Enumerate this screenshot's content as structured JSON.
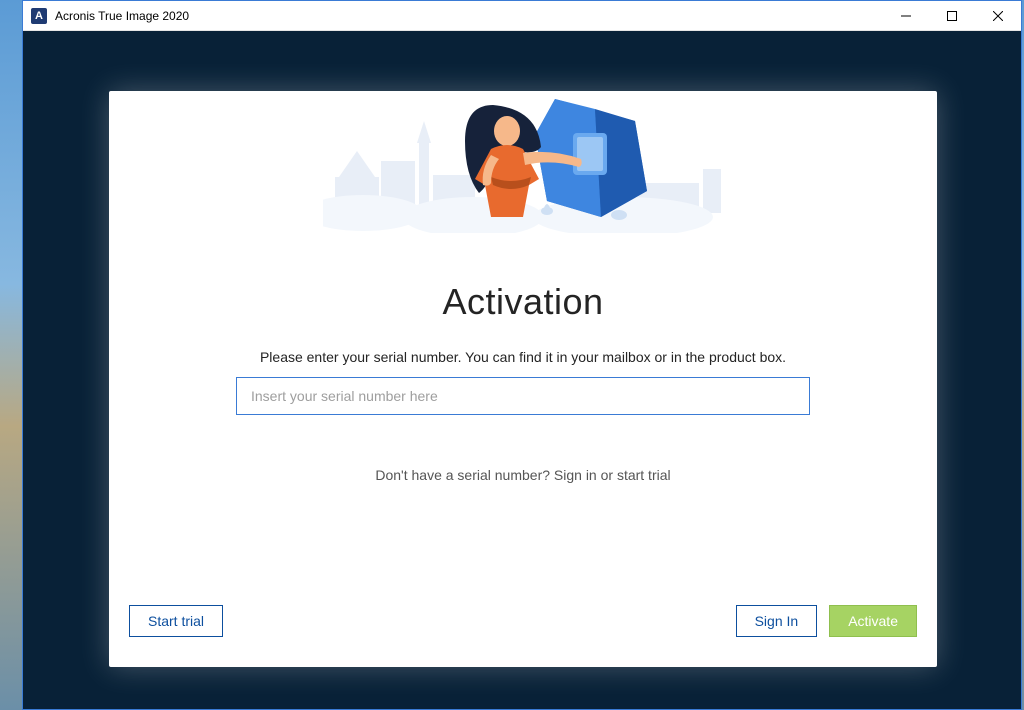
{
  "window": {
    "title": "Acronis True Image 2020",
    "icon_letter": "A"
  },
  "activation": {
    "heading": "Activation",
    "instruction": "Please enter your serial number. You can find it in your mailbox or in the product box.",
    "serial_placeholder": "Insert your serial number here",
    "serial_value": "",
    "hint": "Don't have a serial number? Sign in or start trial"
  },
  "buttons": {
    "start_trial": "Start trial",
    "sign_in": "Sign In",
    "activate": "Activate"
  }
}
